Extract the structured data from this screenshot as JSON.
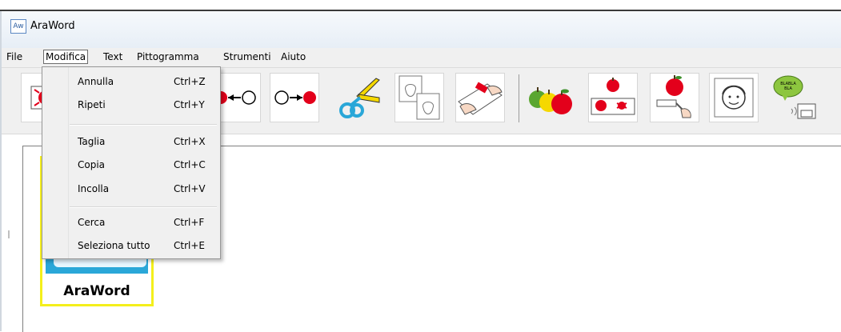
{
  "window": {
    "title": "AraWord",
    "app_icon_text": "Aw"
  },
  "menubar": {
    "items": [
      {
        "label": "File"
      },
      {
        "label": "Modifica",
        "active": true
      },
      {
        "label": "Text"
      },
      {
        "label": "Pittogramma"
      },
      {
        "label": "Strumenti"
      },
      {
        "label": "Aiuto"
      }
    ]
  },
  "edit_menu": {
    "items": [
      {
        "label": "Annulla",
        "shortcut": "Ctrl+Z"
      },
      {
        "label": "Ripeti",
        "shortcut": "Ctrl+Y"
      },
      {
        "label": "Taglia",
        "shortcut": "Ctrl+X"
      },
      {
        "label": "Copia",
        "shortcut": "Ctrl+C"
      },
      {
        "label": "Incolla",
        "shortcut": "Ctrl+V"
      },
      {
        "label": "Cerca",
        "shortcut": "Ctrl+F"
      },
      {
        "label": "Seleziona tutto",
        "shortcut": "Ctrl+E"
      }
    ]
  },
  "toolbar": {
    "icons": [
      "stop-record-icon",
      "previous-pictogram-icon",
      "next-pictogram-icon",
      "cut-scissors-icon",
      "copy-pictogram-icon",
      "paste-glue-icon",
      "apples-group-icon",
      "apples-layout-icon",
      "write-apple-icon",
      "face-icon",
      "speech-icon"
    ]
  },
  "splash": {
    "name": "AraWord",
    "border_color": "#f4ef1b",
    "accent_color": "#2aa7d8"
  },
  "colors": {
    "red": "#e3001b",
    "yellow": "#f5d800",
    "green": "#5aa630",
    "blue": "#2aa7d8"
  }
}
